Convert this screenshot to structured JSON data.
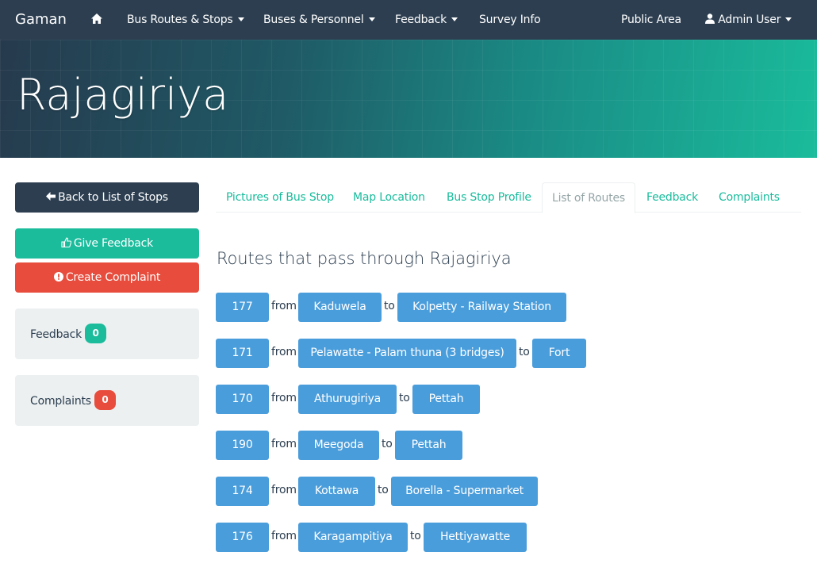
{
  "navbar": {
    "brand": "Gaman",
    "home_icon": "home-icon",
    "items": [
      {
        "label": "Bus Routes & Stops"
      },
      {
        "label": "Buses & Personnel"
      },
      {
        "label": "Feedback"
      },
      {
        "label": "Survey Info"
      }
    ],
    "public_area": "Public Area",
    "user_label": "Admin User",
    "user_icon": "user-icon"
  },
  "header": {
    "title": "Rajagiriya"
  },
  "sidebar": {
    "back_label": "Back to List of Stops",
    "give_feedback_label": "Give Feedback",
    "create_complaint_label": "Create Complaint",
    "feedback": {
      "label": "Feedback",
      "count": "0"
    },
    "complaints": {
      "label": "Complaints",
      "count": "0"
    }
  },
  "tabs": [
    {
      "label": "Pictures of Bus Stop"
    },
    {
      "label": "Map Location"
    },
    {
      "label": "Bus Stop Profile"
    },
    {
      "label": "List of Routes",
      "active": true
    },
    {
      "label": "Feedback"
    },
    {
      "label": "Complaints"
    }
  ],
  "routes": {
    "heading": "Routes that pass through Rajagiriya",
    "from_word": "from",
    "to_word": "to",
    "items": [
      {
        "number": "177",
        "from": "Kaduwela",
        "to": "Kolpetty - Railway Station"
      },
      {
        "number": "171",
        "from": "Pelawatte - Palam thuna (3 bridges)",
        "to": "Fort"
      },
      {
        "number": "170",
        "from": "Athurugiriya",
        "to": "Pettah"
      },
      {
        "number": "190",
        "from": "Meegoda",
        "to": "Pettah"
      },
      {
        "number": "174",
        "from": "Kottawa",
        "to": "Borella - Supermarket"
      },
      {
        "number": "176",
        "from": "Karagampitiya",
        "to": "Hettiyawatte"
      }
    ]
  },
  "colors": {
    "navbar": "#2c3e50",
    "accent_green": "#1abc9c",
    "danger_red": "#e74c3c",
    "route_blue": "#4a9ddb"
  }
}
